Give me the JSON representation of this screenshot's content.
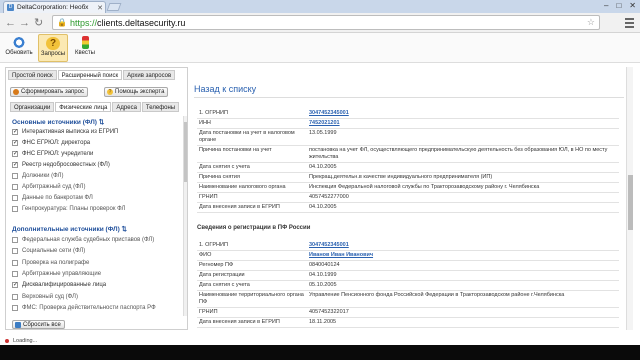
{
  "browser": {
    "tab_title": "DeltaCorporation: Необх",
    "url_scheme": "https://",
    "url_host": "clients.deltasecurity.ru"
  },
  "toolbar": {
    "items": [
      {
        "label": "Обновить",
        "icon": "refresh-icon"
      },
      {
        "label": "Запросы",
        "icon": "question-icon"
      },
      {
        "label": "Квесты",
        "icon": "traffic-light-icon"
      }
    ]
  },
  "left": {
    "search_tabs": [
      "Простой поиск",
      "Расширенный поиск",
      "Архив запросов"
    ],
    "form_request": "Сформировать запрос",
    "expert_help": "Помощь эксперта",
    "inner_tabs": [
      "Организации",
      "Физические лица",
      "Адреса",
      "Телефоны"
    ],
    "main_sources_title": "Основные источники (ФЛ)",
    "main_sources": [
      {
        "label": "Интерактивная выписка из ЕГРИП",
        "checked": true
      },
      {
        "label": "ФНС ЕГРЮЛ: директора",
        "checked": true
      },
      {
        "label": "ФНС ЕГРЮЛ: учредители",
        "checked": true
      },
      {
        "label": "Реестр недобросовестных (ФЛ)",
        "checked": true
      },
      {
        "label": "Должники (ФЛ)",
        "checked": false
      },
      {
        "label": "Арбитражный суд (ФЛ)",
        "checked": false
      },
      {
        "label": "Данные по банкротам ФЛ",
        "checked": false
      },
      {
        "label": "Генпрокуратура: Планы проверок ФЛ",
        "checked": false
      }
    ],
    "extra_sources_title": "Дополнительные источники (ФЛ)",
    "extra_sources": [
      {
        "label": "Федеральная служба судебных приставов (ФЛ)",
        "checked": false
      },
      {
        "label": "Социальные сети (ФЛ)",
        "checked": false
      },
      {
        "label": "Проверка на полиграфе",
        "checked": false
      },
      {
        "label": "Арбитражные управляющие",
        "checked": false
      },
      {
        "label": "Дисквалифицированные лица",
        "checked": true
      },
      {
        "label": "Верховный суд (ФЛ)",
        "checked": false
      },
      {
        "label": "ФМС: Проверка действительности паспорта РФ",
        "checked": false
      }
    ],
    "reset": "Сбросить все"
  },
  "right": {
    "back": "Назад к списку",
    "table1": [
      {
        "k": "1. ОГРНИП",
        "v": "3047452345001",
        "link": true
      },
      {
        "k": "ИНН",
        "v": "7452021201",
        "link": true
      },
      {
        "k": "Дата постановки на учет в налоговом органе",
        "v": "13.05.1999",
        "link": false
      },
      {
        "k": "Причина постановки на учет",
        "v": "постановка на учет ФЛ, осуществляющего предпринимательскую деятельность без образования ЮЛ, в НО по месту жительства",
        "link": false
      },
      {
        "k": "Дата снятия с учета",
        "v": "04.10.2005",
        "link": false
      },
      {
        "k": "Причина снятия",
        "v": "Прекращ.деятельн.в качестве индивидуального предпринимателя (ИП)",
        "link": false
      },
      {
        "k": "Наименование налогового органа",
        "v": "Инспекция Федеральной налоговой службы по Тракторозаводскому району г. Челябинска",
        "link": false
      },
      {
        "k": "ГРНИП",
        "v": "4057452277000",
        "link": false
      },
      {
        "k": "Дата внесения записи в ЕГРИП",
        "v": "04.10.2005",
        "link": false
      }
    ],
    "pf_heading": "Сведения о регистрации в ПФ России",
    "table2": [
      {
        "k": "1. ОГРНИП",
        "v": "3047452345001",
        "link": true
      },
      {
        "k": "ФИО",
        "v": "Иванов Иван Иванович",
        "link": true
      },
      {
        "k": "Регномер ПФ",
        "v": "0840040124",
        "link": false
      },
      {
        "k": "Дата регистрации",
        "v": "04.10.1999",
        "link": false
      },
      {
        "k": "Дата снятия с учета",
        "v": "05.10.2005",
        "link": false
      },
      {
        "k": "Наименование территориального органа ПФ",
        "v": "Управление Пенсионного фонда Российской Федерации в Тракторозаводском районе г.Челябинска",
        "link": false
      },
      {
        "k": "ГРНИП",
        "v": "4057452322017",
        "link": false
      },
      {
        "k": "Дата внесения записи в ЕГРИП",
        "v": "18.11.2005",
        "link": false
      }
    ]
  },
  "status": {
    "text": "Loading..."
  }
}
